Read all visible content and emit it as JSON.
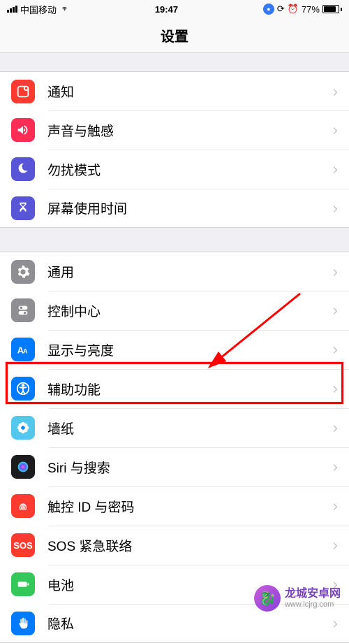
{
  "status": {
    "carrier": "中国移动",
    "time": "19:47",
    "battery_pct": "77%"
  },
  "header": {
    "title": "设置"
  },
  "groups": [
    {
      "rows": [
        {
          "key": "notifications",
          "label": "通知",
          "icon": "notifications-icon",
          "bg": "#ff3b30"
        },
        {
          "key": "sounds",
          "label": "声音与触感",
          "icon": "sounds-icon",
          "bg": "#ff2d55"
        },
        {
          "key": "dnd",
          "label": "勿扰模式",
          "icon": "moon-icon",
          "bg": "#5856d6"
        },
        {
          "key": "screentime",
          "label": "屏幕使用时间",
          "icon": "hourglass-icon",
          "bg": "#5856d6"
        }
      ]
    },
    {
      "rows": [
        {
          "key": "general",
          "label": "通用",
          "icon": "gear-icon",
          "bg": "#8e8e93"
        },
        {
          "key": "control-center",
          "label": "控制中心",
          "icon": "switches-icon",
          "bg": "#8e8e93"
        },
        {
          "key": "display",
          "label": "显示与亮度",
          "icon": "text-size-icon",
          "bg": "#007aff"
        },
        {
          "key": "accessibility",
          "label": "辅助功能",
          "icon": "accessibility-icon",
          "bg": "#007aff",
          "highlighted": true
        },
        {
          "key": "wallpaper",
          "label": "墙纸",
          "icon": "flower-icon",
          "bg": "#54c7ec"
        },
        {
          "key": "siri",
          "label": "Siri 与搜索",
          "icon": "siri-icon",
          "bg": "#1c1c1e"
        },
        {
          "key": "touchid",
          "label": "触控 ID 与密码",
          "icon": "fingerprint-icon",
          "bg": "#ff3b30"
        },
        {
          "key": "sos",
          "label": "SOS 紧急联络",
          "icon": "sos-icon",
          "bg": "#ff3b30"
        },
        {
          "key": "battery",
          "label": "电池",
          "icon": "battery-icon",
          "bg": "#34c759"
        },
        {
          "key": "privacy",
          "label": "隐私",
          "icon": "hand-icon",
          "bg": "#007aff"
        }
      ]
    }
  ],
  "watermark": {
    "line1": "龙城安卓网",
    "line2": "www.lcjrg.com"
  }
}
